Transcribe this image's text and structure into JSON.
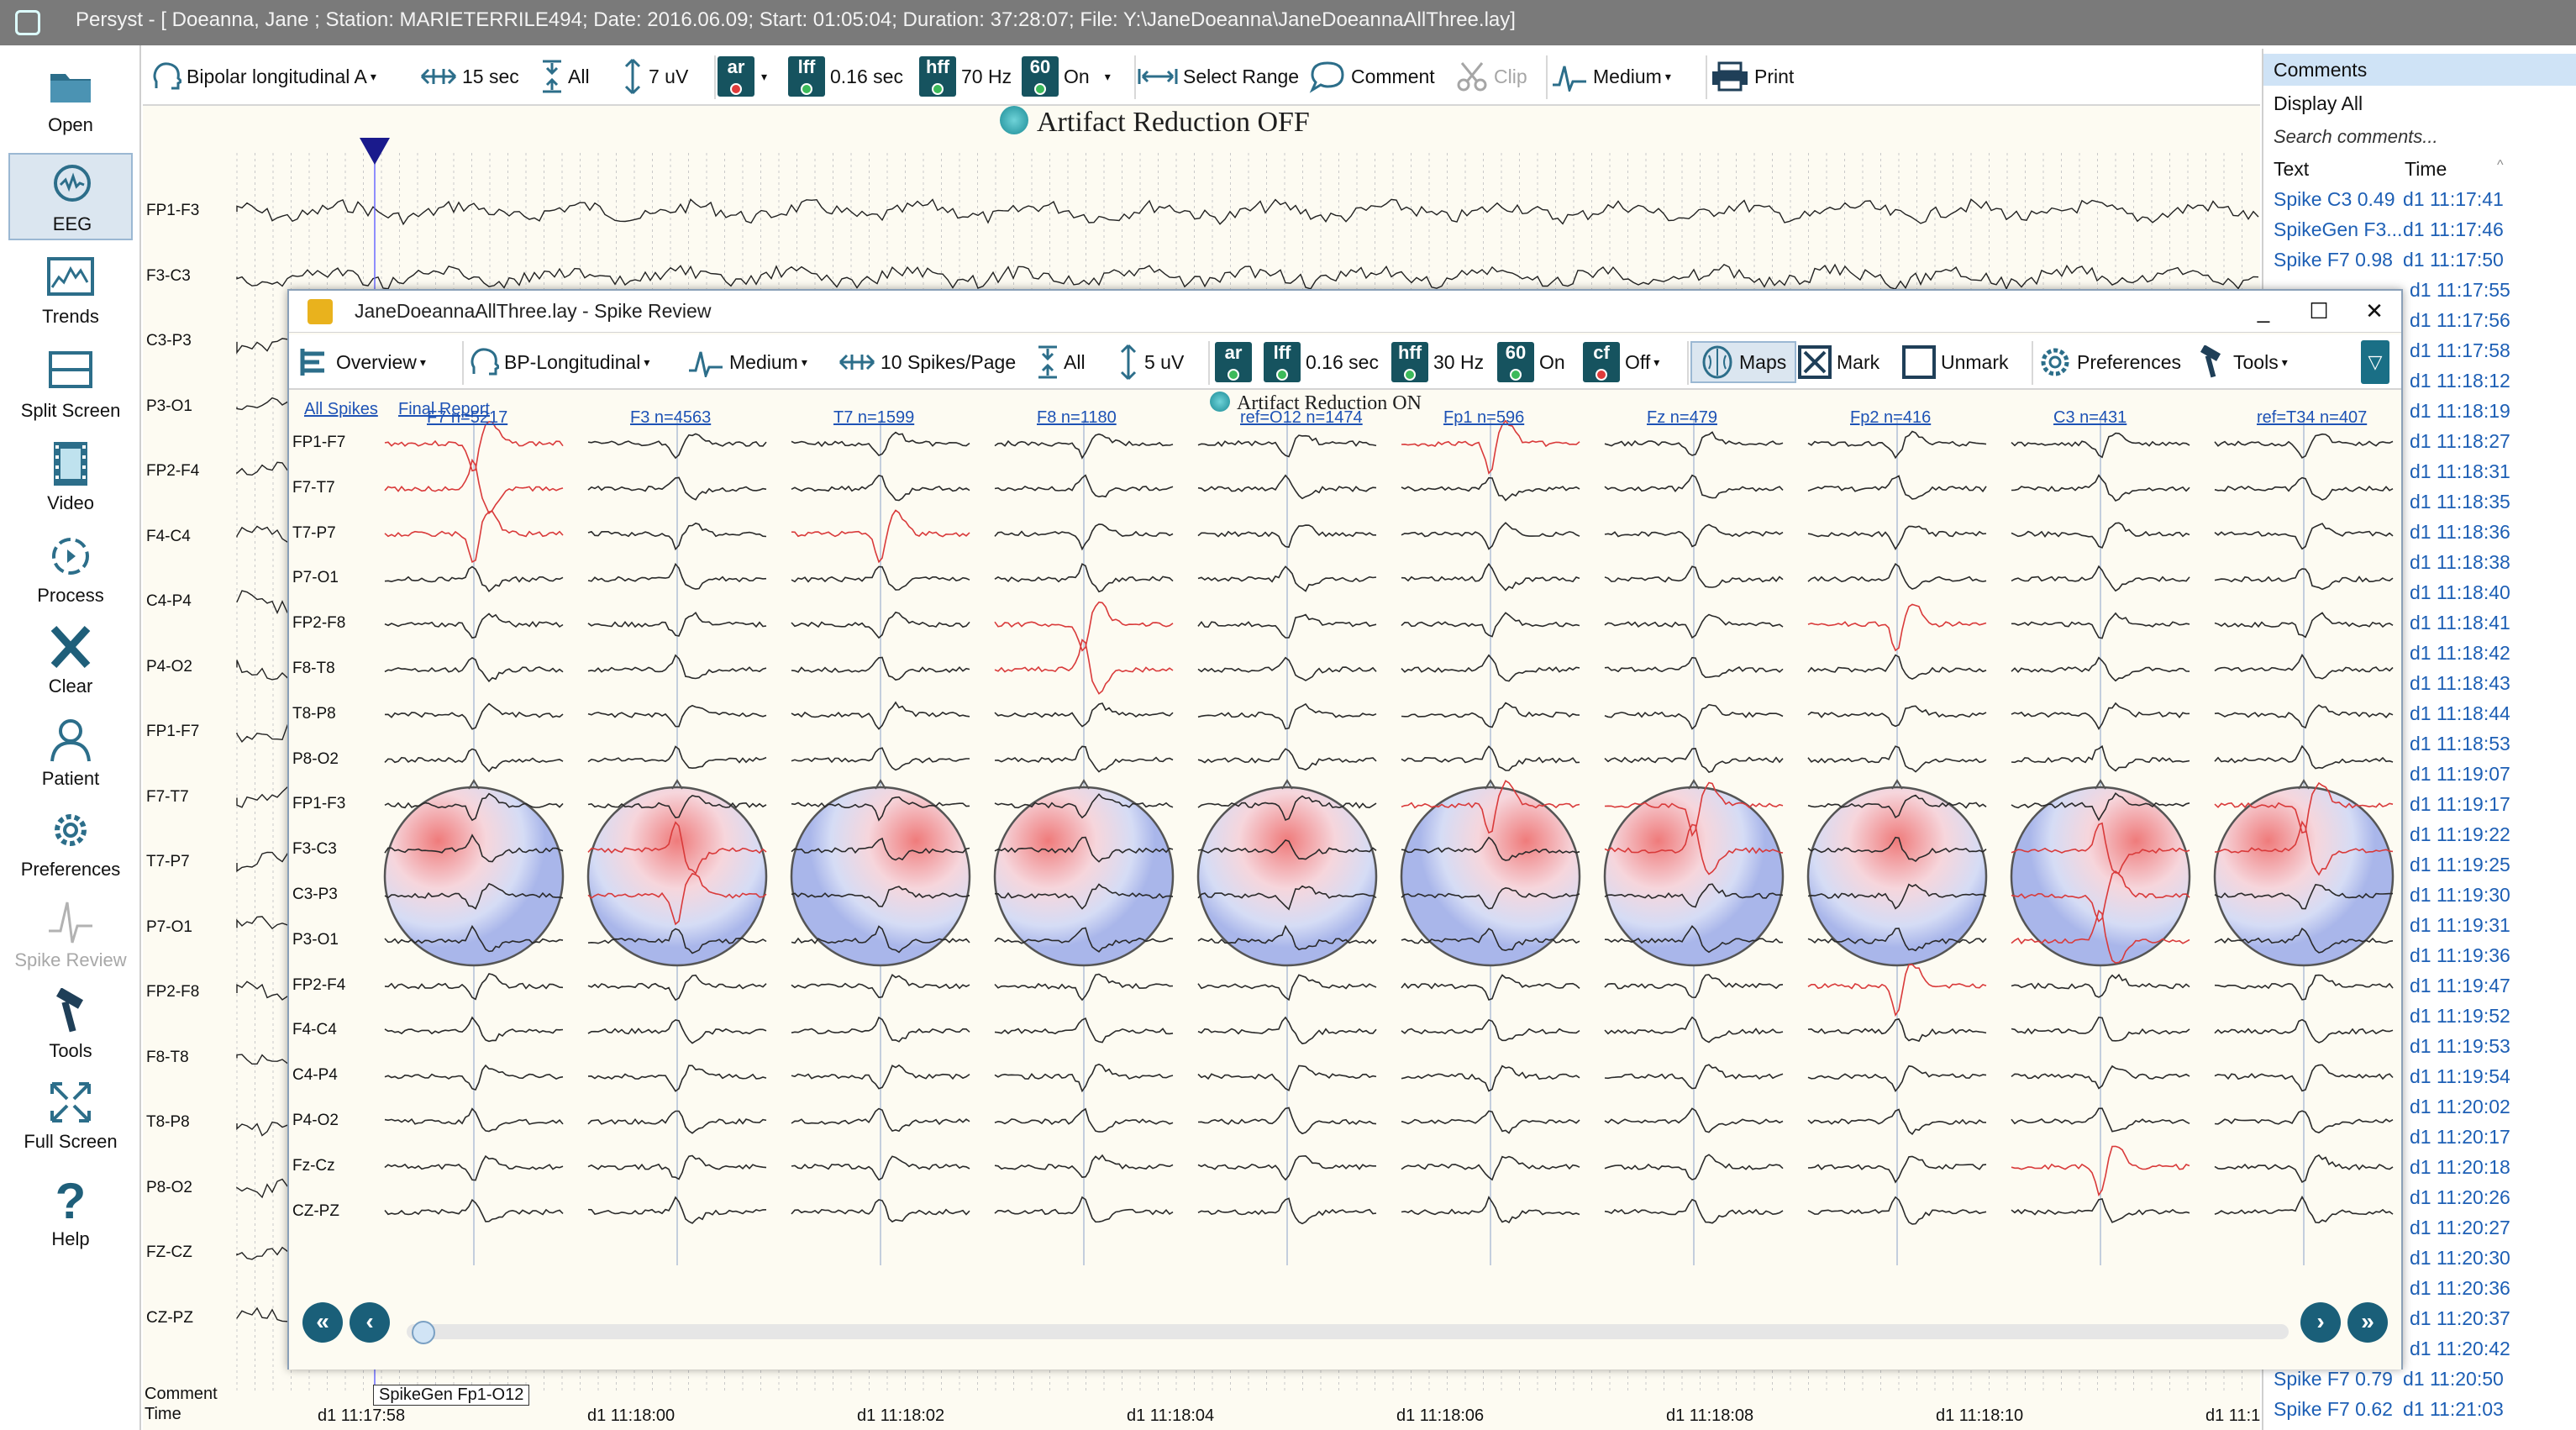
{
  "window": {
    "app_name": "Persyst",
    "title": "Persyst - [ Doeanna,  Jane ; Station: MARIETERRILE494; Date: 2016.06.09; Start: 01:05:04; Duration: 37:28:07; File: Y:\\JaneDoeanna\\JaneDoeannaAllThree.lay]"
  },
  "sidebar": {
    "items": [
      {
        "label": "Open",
        "icon": "folder-icon"
      },
      {
        "label": "EEG",
        "icon": "brain-head-icon",
        "active": true
      },
      {
        "label": "Trends",
        "icon": "trends-chart-icon"
      },
      {
        "label": "Split Screen",
        "icon": "split-screen-icon"
      },
      {
        "label": "Video",
        "icon": "film-icon"
      },
      {
        "label": "Process",
        "icon": "process-cycle-icon"
      },
      {
        "label": "Clear",
        "icon": "x-icon"
      },
      {
        "label": "Patient",
        "icon": "patient-icon"
      },
      {
        "label": "Preferences",
        "icon": "gear-icon"
      },
      {
        "label": "Spike Review",
        "icon": "spike-icon",
        "disabled": true
      },
      {
        "label": "Tools",
        "icon": "hammer-icon"
      },
      {
        "label": "Full Screen",
        "icon": "expand-arrows-icon"
      },
      {
        "label": "Help",
        "icon": "question-icon"
      }
    ]
  },
  "toolbar": {
    "montage": "Bipolar longitudinal A",
    "timebase": "15 sec",
    "channels": "All",
    "sensitivity": "7 uV",
    "ar_badge": "ar",
    "lff_badge": "lff",
    "lff_value": "0.16 sec",
    "hff_badge": "hff",
    "hff_value": "70 Hz",
    "notch_badge": "60",
    "notch_value": "On",
    "select_range": "Select Range",
    "comment": "Comment",
    "clip": "Clip",
    "speed": "Medium",
    "print": "Print"
  },
  "main_eeg": {
    "artifact_label": "Artifact Reduction OFF",
    "channels": [
      "FP1-F3",
      "F3-C3",
      "C3-P3",
      "P3-O1",
      "FP2-F4",
      "F4-C4",
      "C4-P4",
      "P4-O2",
      "FP1-F7",
      "F7-T7",
      "T7-P7",
      "P7-O1",
      "FP2-F8",
      "F8-T8",
      "T8-P8",
      "P8-O2",
      "FZ-CZ",
      "CZ-PZ"
    ],
    "comment_row_label": "Comment",
    "time_row_label": "Time",
    "comment_tag": "SpikeGen Fp1-O12",
    "times": [
      "d1 11:17:58",
      "d1 11:18:00",
      "d1 11:18:02",
      "d1 11:18:04",
      "d1 11:18:06",
      "d1 11:18:08",
      "d1 11:18:10",
      "d1 11:1"
    ]
  },
  "comments_panel": {
    "header": "Comments",
    "display_all": "Display All",
    "search_placeholder": "Search comments...",
    "col_text": "Text",
    "col_time": "Time",
    "rows": [
      {
        "text": "Spike C3 0.49",
        "time": "d1 11:17:41"
      },
      {
        "text": "SpikeGen F3...",
        "time": "d1 11:17:46"
      },
      {
        "text": "Spike F7 0.98",
        "time": "d1 11:17:50"
      },
      {
        "text": "",
        "time": "d1 11:17:55"
      },
      {
        "text": "",
        "time": "d1 11:17:56"
      },
      {
        "text": "",
        "time": "d1 11:17:58"
      },
      {
        "text": "",
        "time": "d1 11:18:12"
      },
      {
        "text": "",
        "time": "d1 11:18:19"
      },
      {
        "text": "",
        "time": "d1 11:18:27"
      },
      {
        "text": "",
        "time": "d1 11:18:31"
      },
      {
        "text": "",
        "time": "d1 11:18:35"
      },
      {
        "text": "",
        "time": "d1 11:18:36"
      },
      {
        "text": "",
        "time": "d1 11:18:38"
      },
      {
        "text": "",
        "time": "d1 11:18:40"
      },
      {
        "text": "",
        "time": "d1 11:18:41"
      },
      {
        "text": "",
        "time": "d1 11:18:42"
      },
      {
        "text": "",
        "time": "d1 11:18:43"
      },
      {
        "text": "",
        "time": "d1 11:18:44"
      },
      {
        "text": "",
        "time": "d1 11:18:53"
      },
      {
        "text": "",
        "time": "d1 11:19:07"
      },
      {
        "text": "",
        "time": "d1 11:19:17"
      },
      {
        "text": "",
        "time": "d1 11:19:22"
      },
      {
        "text": "",
        "time": "d1 11:19:25"
      },
      {
        "text": "",
        "time": "d1 11:19:30"
      },
      {
        "text": "",
        "time": "d1 11:19:31"
      },
      {
        "text": "",
        "time": "d1 11:19:36"
      },
      {
        "text": "",
        "time": "d1 11:19:47"
      },
      {
        "text": "",
        "time": "d1 11:19:52"
      },
      {
        "text": "",
        "time": "d1 11:19:53"
      },
      {
        "text": "",
        "time": "d1 11:19:54"
      },
      {
        "text": "",
        "time": "d1 11:20:02"
      },
      {
        "text": "",
        "time": "d1 11:20:17"
      },
      {
        "text": "",
        "time": "d1 11:20:18"
      },
      {
        "text": "",
        "time": "d1 11:20:26"
      },
      {
        "text": "",
        "time": "d1 11:20:27"
      },
      {
        "text": "",
        "time": "d1 11:20:30"
      },
      {
        "text": "",
        "time": "d1 11:20:36"
      },
      {
        "text": "",
        "time": "d1 11:20:37"
      },
      {
        "text": "",
        "time": "d1 11:20:42"
      },
      {
        "text": "Spike F7 0.79",
        "time": "d1 11:20:50"
      },
      {
        "text": "Spike F7 0.62",
        "time": "d1 11:21:03"
      }
    ]
  },
  "spike_review": {
    "title": "JaneDoeannaAllThree.lay - Spike Review",
    "toolbar": {
      "overview": "Overview",
      "montage": "BP-Longitudinal",
      "speed": "Medium",
      "spikes_per_page": "10 Spikes/Page",
      "channels": "All",
      "sensitivity": "5 uV",
      "ar_badge": "ar",
      "lff_badge": "lff",
      "lff_value": "0.16 sec",
      "hff_badge": "hff",
      "hff_value": "30 Hz",
      "notch_badge": "60",
      "notch_value": "On",
      "cf_badge": "cf",
      "cf_value": "Off",
      "maps": "Maps",
      "mark": "Mark",
      "unmark": "Unmark",
      "preferences": "Preferences",
      "tools": "Tools"
    },
    "all_spikes_link": "All Spikes",
    "final_report_link": "Final Report",
    "artifact_label": "Artifact Reduction ON",
    "spike_groups": [
      "F7 n=5217",
      "F3 n=4563",
      "T7 n=1599",
      "F8 n=1180",
      "ref=O12 n=1474",
      "Fp1 n=596",
      "Fz n=479",
      "Fp2 n=416",
      "C3 n=431",
      "ref=T34 n=407"
    ],
    "channels": [
      "FP1-F7",
      "F7-T7",
      "T7-P7",
      "P7-O1",
      "FP2-F8",
      "F8-T8",
      "T8-P8",
      "P8-O2",
      "FP1-F3",
      "F3-C3",
      "C3-P3",
      "P3-O1",
      "FP2-F4",
      "F4-C4",
      "C4-P4",
      "P4-O2",
      "Fz-Cz",
      "CZ-PZ"
    ]
  }
}
